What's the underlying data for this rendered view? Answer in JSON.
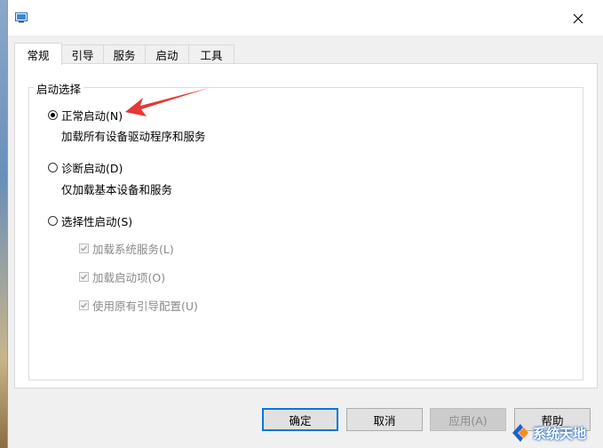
{
  "tabs": [
    {
      "label": "常规",
      "active": true
    },
    {
      "label": "引导",
      "active": false
    },
    {
      "label": "服务",
      "active": false
    },
    {
      "label": "启动",
      "active": false
    },
    {
      "label": "工具",
      "active": false
    }
  ],
  "group": {
    "label": "启动选择"
  },
  "options": {
    "normal": {
      "label": "正常启动(N)",
      "desc": "加载所有设备驱动程序和服务",
      "checked": true
    },
    "diagnostic": {
      "label": "诊断启动(D)",
      "desc": "仅加载基本设备和服务",
      "checked": false
    },
    "selective": {
      "label": "选择性启动(S)",
      "checked": false
    }
  },
  "checks": [
    {
      "label": "加载系统服务(L)",
      "checked": true,
      "disabled": true
    },
    {
      "label": "加载启动项(O)",
      "checked": true,
      "disabled": true
    },
    {
      "label": "使用原有引导配置(U)",
      "checked": true,
      "disabled": true
    }
  ],
  "buttons": {
    "ok": "确定",
    "cancel": "取消",
    "apply": "应用(A)",
    "help": "帮助"
  },
  "watermark": {
    "text": "系统天地"
  },
  "colors": {
    "accent": "#0078d7",
    "arrow": "#e53935"
  }
}
